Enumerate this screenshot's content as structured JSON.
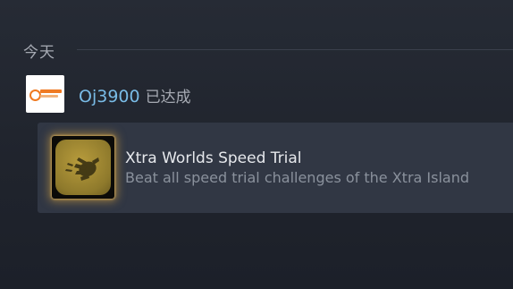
{
  "section": {
    "title": "今天"
  },
  "event": {
    "username": "Oj3900",
    "action": "已达成"
  },
  "achievement": {
    "title": "Xtra Worlds Speed Trial",
    "description": "Beat all speed trial challenges of the Xtra Island"
  },
  "colors": {
    "username": "#79bbe6",
    "card_bg": "#313744",
    "icon_glow": "#e2aa3c"
  },
  "icons": {
    "avatar": "user-avatar-logo",
    "achievement": "running-hand-emblem-icon"
  }
}
